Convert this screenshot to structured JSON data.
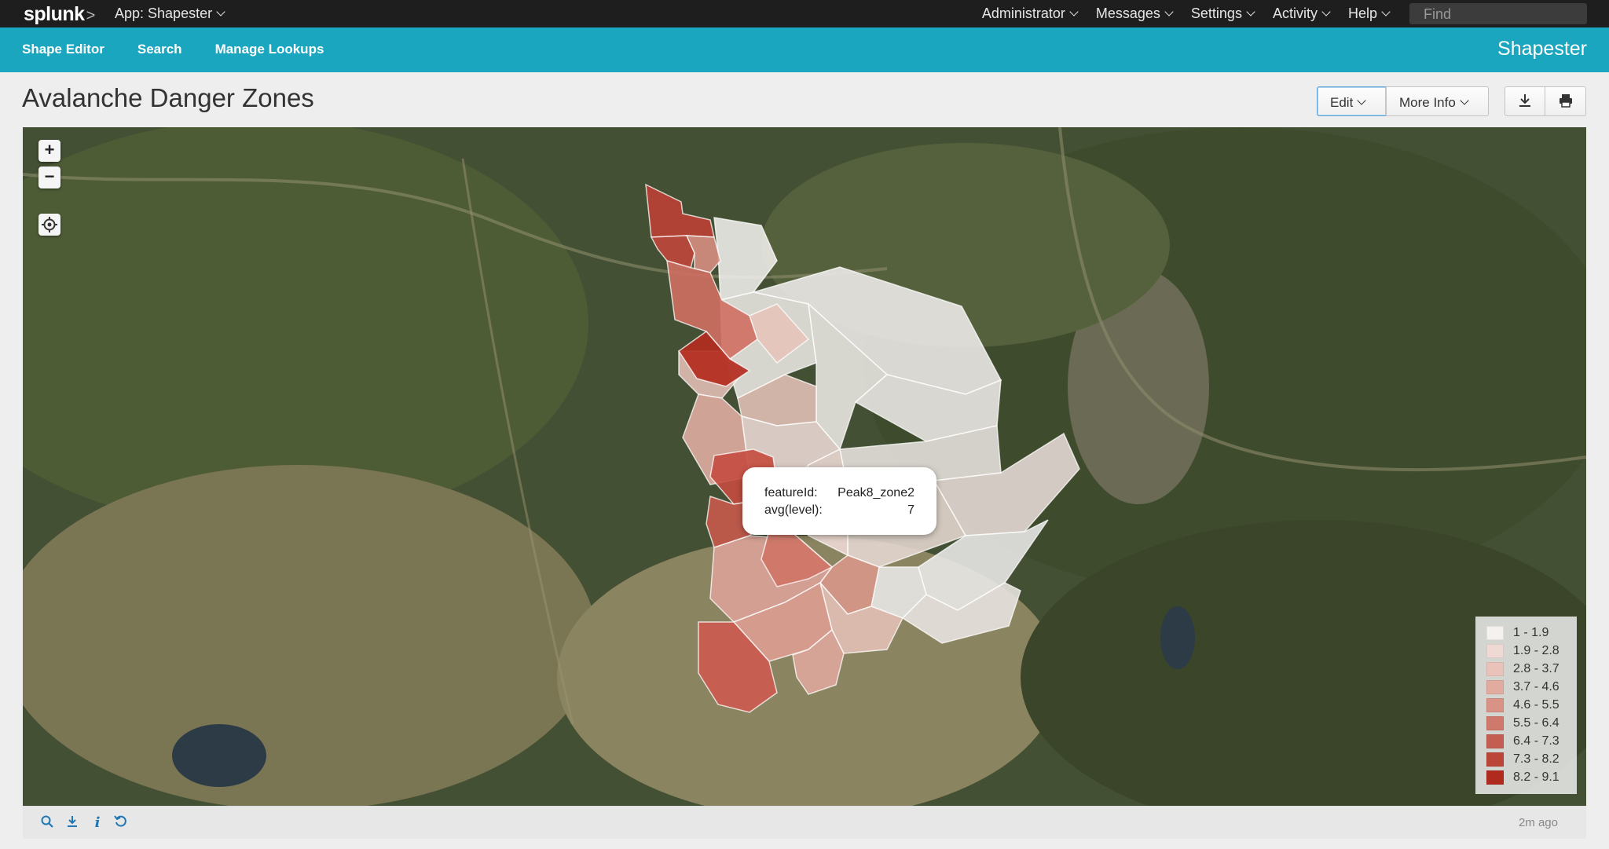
{
  "topbar": {
    "logo": "splunk",
    "app_label": "App: Shapester",
    "nav": [
      {
        "label": "Administrator"
      },
      {
        "label": "Messages"
      },
      {
        "label": "Settings"
      },
      {
        "label": "Activity"
      },
      {
        "label": "Help"
      }
    ],
    "find_placeholder": "Find"
  },
  "appbar": {
    "nav": [
      {
        "label": "Shape Editor"
      },
      {
        "label": "Search"
      },
      {
        "label": "Manage Lookups"
      }
    ],
    "app_name": "Shapester",
    "accent_color": "#1aa6bf"
  },
  "page": {
    "title": "Avalanche Danger Zones",
    "edit_label": "Edit",
    "more_info_label": "More Info"
  },
  "map": {
    "zoom_in": "+",
    "zoom_out": "−",
    "tooltip": {
      "key1": "featureId:",
      "val1": "Peak8_zone2",
      "key2": "avg(level):",
      "val2": "7"
    },
    "legend": [
      {
        "label": "1 - 1.9",
        "color": "#f4f1ef"
      },
      {
        "label": "1.9 - 2.8",
        "color": "#efd9d4"
      },
      {
        "label": "2.8 - 3.7",
        "color": "#e9c2b9"
      },
      {
        "label": "3.7 - 4.6",
        "color": "#e2aba0"
      },
      {
        "label": "4.6 - 5.5",
        "color": "#d99286"
      },
      {
        "label": "5.5 - 6.4",
        "color": "#cf786c"
      },
      {
        "label": "6.4 - 7.3",
        "color": "#c55e52"
      },
      {
        "label": "7.3 - 8.2",
        "color": "#bb4538"
      },
      {
        "label": "8.2 - 9.1",
        "color": "#b02a1e"
      }
    ]
  },
  "footer": {
    "time_ago": "2m ago"
  }
}
